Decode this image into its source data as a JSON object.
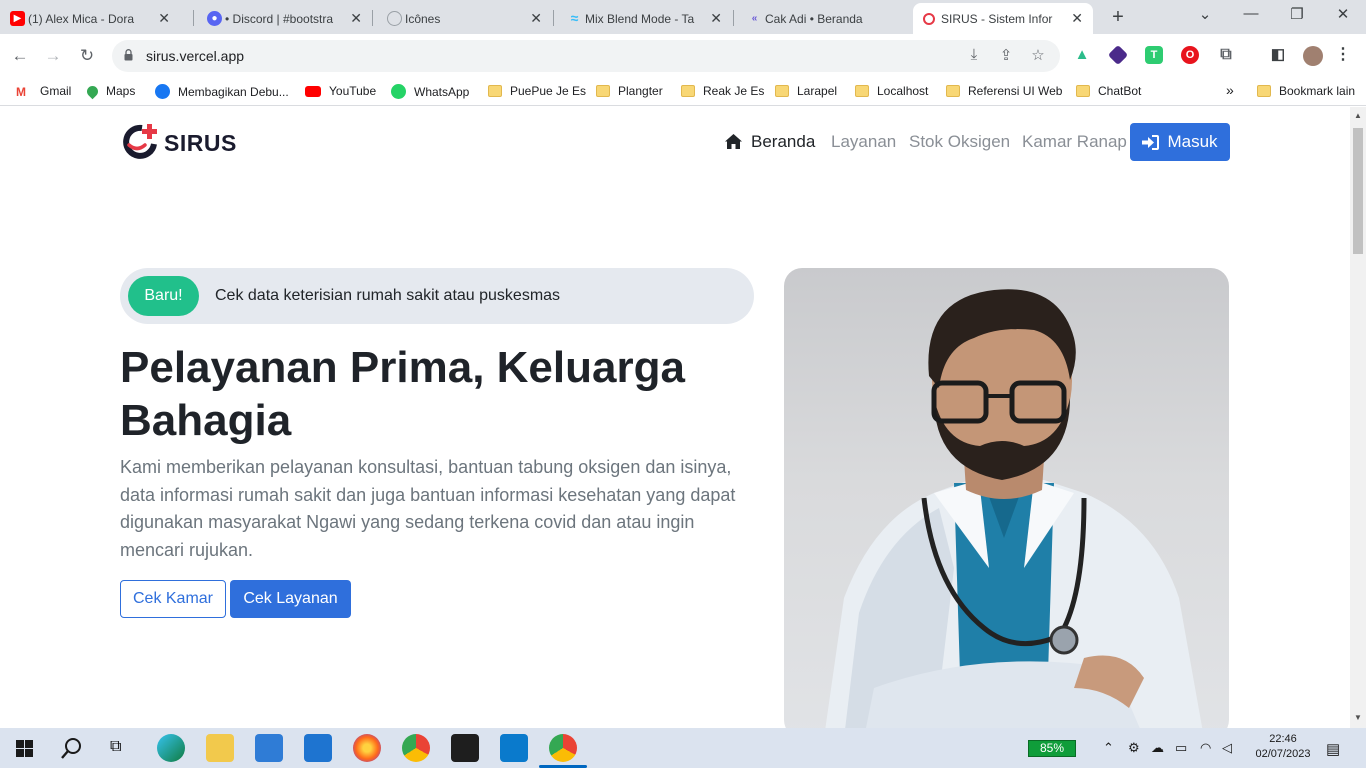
{
  "browser": {
    "tabs": [
      {
        "label": "(1) Alex Mica - Dora",
        "favicon": "youtube-icon",
        "color": "#ff0000"
      },
      {
        "label": "• Discord | #bootstra",
        "favicon": "discord-icon",
        "color": "#5865f2"
      },
      {
        "label": "Icônes",
        "favicon": "iconify-icon",
        "color": "#9aa0a6"
      },
      {
        "label": "Mix Blend Mode - Ta",
        "favicon": "tailwind-icon",
        "color": "#38bdf8"
      },
      {
        "label": "Cak Adi • Beranda",
        "favicon": "blog-icon",
        "color": "#6b5bd6"
      },
      {
        "label": "SIRUS - Sistem Infor",
        "favicon": "sirus-icon",
        "color": "#e63946",
        "active": true
      }
    ],
    "url": "sirus.vercel.app",
    "bookmarks": [
      {
        "label": "Gmail",
        "icon": "gmail-icon"
      },
      {
        "label": "Maps",
        "icon": "maps-icon"
      },
      {
        "label": "Membagikan Debu...",
        "icon": "facebook-icon"
      },
      {
        "label": "YouTube",
        "icon": "youtube-icon"
      },
      {
        "label": "WhatsApp",
        "icon": "whatsapp-icon"
      },
      {
        "label": "PuePue Je Es",
        "icon": "folder-icon"
      },
      {
        "label": "Plangter",
        "icon": "folder-icon"
      },
      {
        "label": "Reak Je Es",
        "icon": "folder-icon"
      },
      {
        "label": "Larapel",
        "icon": "folder-icon"
      },
      {
        "label": "Localhost",
        "icon": "folder-icon"
      },
      {
        "label": "Referensi UI Web",
        "icon": "folder-icon"
      },
      {
        "label": "ChatBot",
        "icon": "folder-icon"
      }
    ],
    "overflow": "»",
    "other_bookmarks": "Bookmark lain"
  },
  "site": {
    "brand": "SIRUS",
    "nav": {
      "home": "Beranda",
      "services": "Layanan",
      "oxygen": "Stok Oksigen",
      "rooms": "Kamar Ranap",
      "login": "Masuk"
    },
    "announcement": {
      "badge": "Baru!",
      "text": "Cek data keterisian rumah sakit atau puskesmas"
    },
    "hero": {
      "title": "Pelayanan Prima, Keluarga Bahagia",
      "description": "Kami memberikan pelayanan konsultasi, bantuan tabung oksigen dan isinya, data informasi rumah sakit dan juga bantuan informasi kesehatan yang dapat digunakan masyarakat Ngawi yang sedang terkena covid dan atau ingin mencari rujukan.",
      "btn_rooms": "Cek Kamar",
      "btn_services": "Cek Layanan"
    },
    "colors": {
      "primary": "#2f6fdc",
      "badge": "#21c08b",
      "brand_accent": "#e63946"
    }
  },
  "taskbar": {
    "battery": "85%",
    "time": "22:46",
    "date": "02/07/2023"
  }
}
